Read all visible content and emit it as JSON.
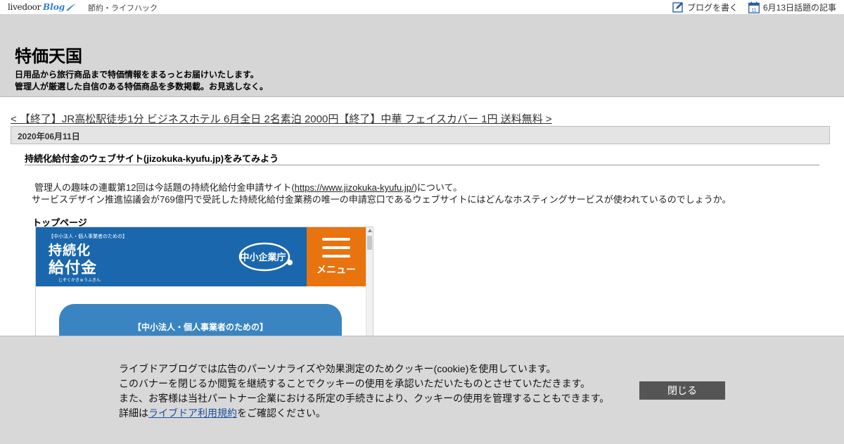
{
  "topbar": {
    "logo_text": "livedoor",
    "logo_blog": "Blog",
    "category": "節約・ライフハック",
    "write_blog": "ブログを書く",
    "calendar_day": "11",
    "topics_link": "6月13日話題の記事"
  },
  "header": {
    "site_title": "特価天国",
    "description_line1": "日用品から旅行商品まで特価情報をまるっとお届けいたします。",
    "description_line2": "管理人が厳選した自信のある特価商品を多数掲載。お見逃しなく。"
  },
  "nav": {
    "prev": "< 【終了】JR高松駅徒歩1分 ビジネスホテル 6月全日 2名素泊 2000円",
    "next": "【終了】中華 フェイスカバー 1円 送料無料 >"
  },
  "article": {
    "date": "2020年06月11日",
    "title": "持続化給付金のウェブサイト(jizokuka-kyufu.jp)をみてみよう",
    "body_line1_before": "管理人の趣味の連載第12回は今話題の持続化給付金申請サイト(",
    "body_line1_link": "https://www.jizokuka-kyufu.jp/",
    "body_line1_after": ")について。",
    "body_line2": "サービスデザイン推進協議会が769億円で受託した持続化給付金業務の唯一の申請窓口であるウェブサイトにはどんなホスティングサービスが使われているのでしょうか。",
    "section_label": "トップページ",
    "screenshot": {
      "small_label": "【中小法人・個人事業者のための】",
      "big_line1": "持続化",
      "big_line2": "給付金",
      "kana": "じぞくかきゅうふきん",
      "agency": "中小企業庁",
      "menu_label": "メニュー",
      "card_text": "【中小法人・個人事業者のための】"
    }
  },
  "cookie": {
    "line1": "ライブドアブログでは広告のパーソナライズや効果測定のためクッキー(cookie)を使用しています。",
    "line2": "このバナーを閉じるか閲覧を継続することでクッキーの使用を承認いただいたものとさせていただきます。",
    "line3": "また、お客様は当社パートナー企業における所定の手続きにより、クッキーの使用を管理することもできます。",
    "line4_before": "詳細は",
    "line4_link": "ライブドア利用規約",
    "line4_after": "をご確認ください。",
    "close_label": "閉じる"
  },
  "colors": {
    "header_bg": "#d6d6d6",
    "cookie_bg": "#d8d8d8",
    "site_blue": "#1a67ad",
    "menu_orange": "#e8730f",
    "blog_blue": "#2f7fd1"
  }
}
